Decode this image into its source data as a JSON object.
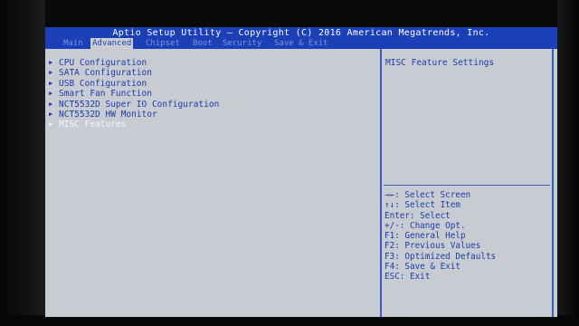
{
  "title": "Aptio Setup Utility – Copyright (C) 2016 American Megatrends, Inc.",
  "tabs": [
    "Main",
    "Advanced",
    "Chipset",
    "Boot",
    "Security",
    "Save & Exit"
  ],
  "active_tab": "Advanced",
  "menu_items": [
    {
      "label": "CPU Configuration",
      "selected": false
    },
    {
      "label": "SATA Configuration",
      "selected": false
    },
    {
      "label": "USB Configuration",
      "selected": false
    },
    {
      "label": "Smart Fan Function",
      "selected": false
    },
    {
      "label": "NCT5532D Super IO Configuration",
      "selected": false
    },
    {
      "label": "NCT5532D HW Monitor",
      "selected": false
    },
    {
      "label": "MISC Features",
      "selected": true
    }
  ],
  "help": {
    "title": "MISC Feature Settings",
    "keys": [
      "→←: Select Screen",
      "↑↓: Select Item",
      "Enter: Select",
      "+/-: Change Opt.",
      "F1: General Help",
      "F2: Previous Values",
      "F3: Optimized Defaults",
      "F4: Save & Exit",
      "ESC: Exit"
    ]
  },
  "colors": {
    "header_blue": "#1a3fb7",
    "panel_gray": "#c8ccd2",
    "text_blue": "#1a3da8",
    "selected_text": "#f4f6fa"
  }
}
